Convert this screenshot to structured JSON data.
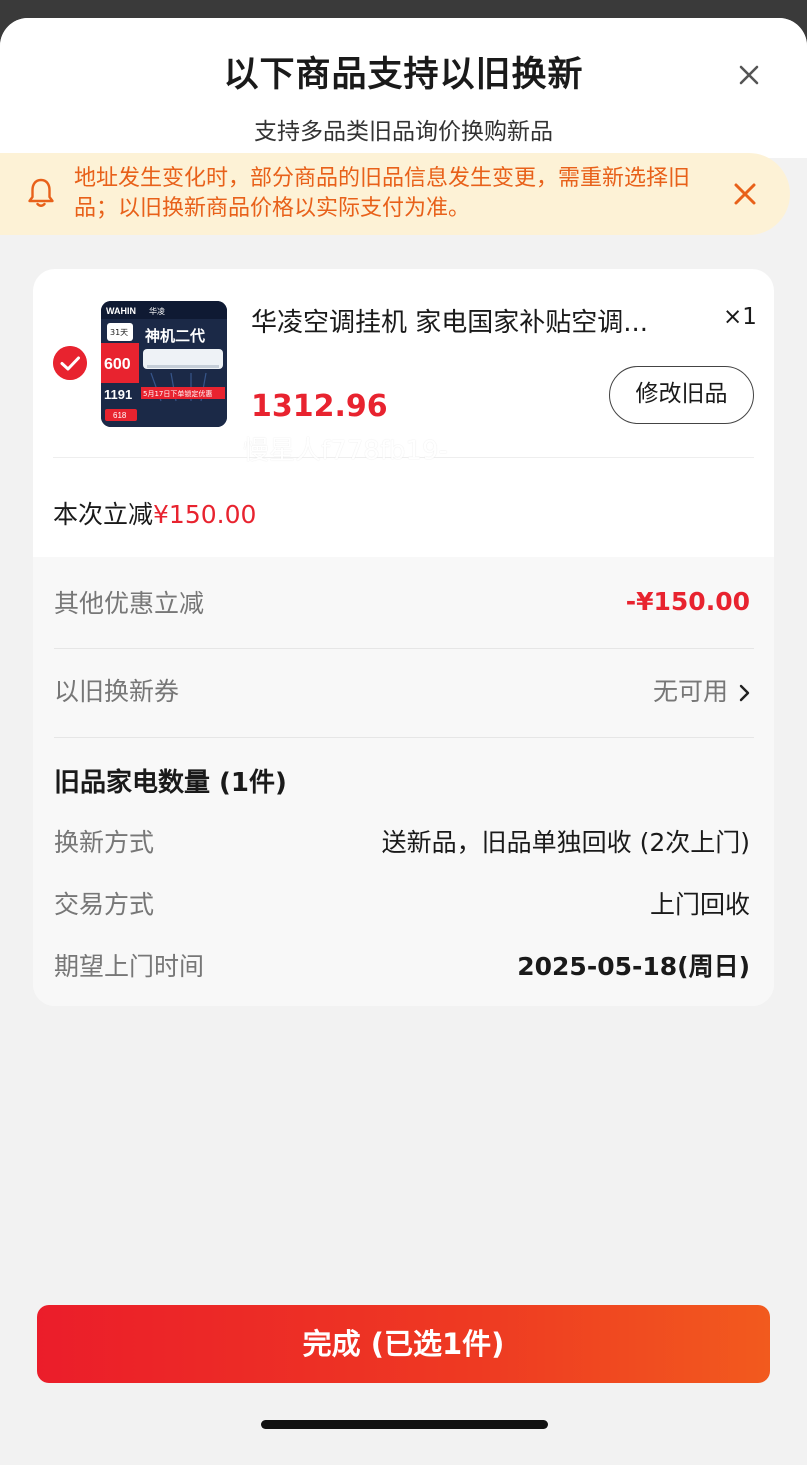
{
  "header": {
    "title": "以下商品支持以旧换新",
    "subtitle": "支持多品类旧品询价换购新品"
  },
  "notice": {
    "text": "地址发生变化时，部分商品的旧品信息发生变更，需重新选择旧品；以旧换新商品价格以实际支付为准。"
  },
  "product": {
    "name": "华凌空调挂机 家电国家补贴空调...",
    "quantity": "×1",
    "price": "1312.96",
    "modify_label": "修改旧品",
    "thumb": {
      "brand": "WAHIN",
      "brand_cn": "华凌",
      "headline": "神机二代",
      "badge_top": "31天",
      "badge_num": "600",
      "price_num": "1191",
      "banner": "5月17日下单锁定优惠",
      "tag": "618"
    }
  },
  "discount": {
    "label": "本次立减",
    "amount": "¥150.00"
  },
  "details": {
    "other_label": "其他优惠立减",
    "other_value": "-¥150.00",
    "coupon_label": "以旧换新券",
    "coupon_value": "无可用",
    "watermark": "慢星人f778fb19-",
    "section_title": "旧品家电数量 (1件)",
    "exchange_label": "换新方式",
    "exchange_value": "送新品，旧品单独回收 (2次上门)",
    "trade_label": "交易方式",
    "trade_value": "上门回收",
    "time_label": "期望上门时间",
    "time_value": "2025-05-18(周日)"
  },
  "footer": {
    "done_label": "完成 (已选1件)"
  },
  "colors": {
    "accent_red": "#e8232f",
    "notice_bg": "#fdf2d6",
    "notice_text": "#e8611a"
  }
}
